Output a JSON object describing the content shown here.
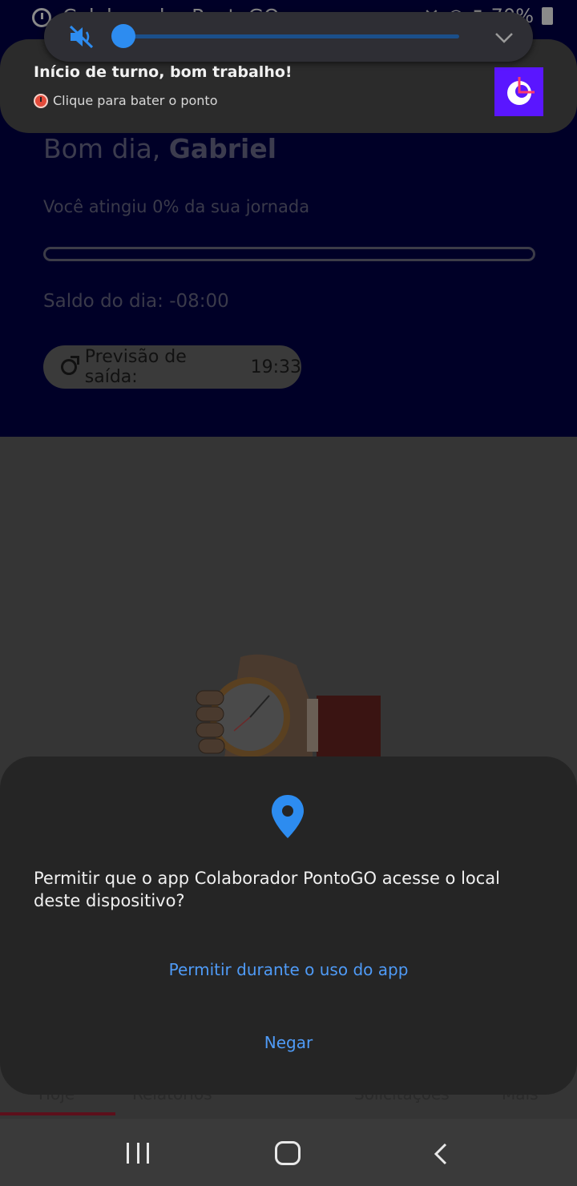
{
  "status_bar": {
    "app_title": "Colaborador PontoGO",
    "battery": "70%"
  },
  "volume_panel": {
    "level_percent": 0,
    "muted": true,
    "icons": [
      "volume-mute-icon",
      "chevron-down-icon"
    ],
    "accent_color": "#2d8cf0"
  },
  "notification": {
    "title": "Início de turno, bom trabalho!",
    "subtitle": "Clique para bater o ponto",
    "icon": "alarm-clock-icon"
  },
  "app": {
    "greeting_prefix": "Bom dia,",
    "user_name": "Gabriel",
    "journey_text": "Você atingiu 0% da sua jornada",
    "journey_progress": 0,
    "saldo_text": "Saldo do dia: -08:00",
    "previsao_label": "Previsão de saída:",
    "previsao_time": "19:33"
  },
  "tabs": {
    "items": [
      "Hoje",
      "Relatórios",
      "Solicitações",
      "Mais"
    ]
  },
  "dialog": {
    "icon": "location-pin-icon",
    "message": "Permitir que o app Colaborador PontoGO acesse o local deste dispositivo?",
    "allow_label": "Permitir durante o uso do app",
    "deny_label": "Negar"
  },
  "navbar": {
    "icons": [
      "recents-icon",
      "home-icon",
      "back-icon"
    ]
  }
}
